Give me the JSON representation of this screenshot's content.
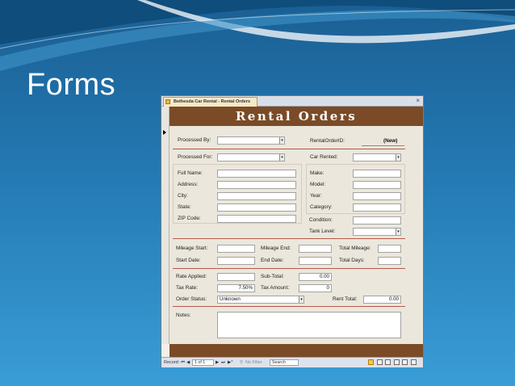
{
  "slide": {
    "title": "Forms"
  },
  "window": {
    "tab_label": "Bethesda Car Rental - Rental Orders",
    "close_glyph": "×",
    "header_title": "Rental Orders"
  },
  "form": {
    "processed_by": {
      "label": "Processed By:",
      "value": ""
    },
    "rental_order_id": {
      "label": "RentalOrderID:",
      "value": "(New)"
    },
    "processed_for": {
      "label": "Processed For:",
      "value": ""
    },
    "car_rented": {
      "label": "Car Rented:",
      "value": ""
    },
    "full_name": {
      "label": "Full Name:",
      "value": ""
    },
    "address": {
      "label": "Address:",
      "value": ""
    },
    "city": {
      "label": "City:",
      "value": ""
    },
    "state": {
      "label": "State:",
      "value": ""
    },
    "zip": {
      "label": "ZIP Code:",
      "value": ""
    },
    "make": {
      "label": "Make:",
      "value": ""
    },
    "model": {
      "label": "Model:",
      "value": ""
    },
    "year": {
      "label": "Year:",
      "value": ""
    },
    "category": {
      "label": "Category:",
      "value": ""
    },
    "condition": {
      "label": "Condition:",
      "value": ""
    },
    "tank_level": {
      "label": "Tank Level:",
      "value": ""
    },
    "mileage_start": {
      "label": "Mileage Start:",
      "value": ""
    },
    "mileage_end": {
      "label": "Mileage End:",
      "value": ""
    },
    "total_mileage": {
      "label": "Total Mileage:",
      "value": ""
    },
    "start_date": {
      "label": "Start Date:",
      "value": ""
    },
    "end_date": {
      "label": "End Date:",
      "value": ""
    },
    "total_days": {
      "label": "Total Days:",
      "value": ""
    },
    "rate_applied": {
      "label": "Rate Applied:",
      "value": ""
    },
    "sub_total": {
      "label": "Sub-Total:",
      "value": "0.00"
    },
    "tax_rate": {
      "label": "Tax Rate:",
      "value": "7.50%"
    },
    "tax_amount": {
      "label": "Tax Amount:",
      "value": "0"
    },
    "order_status": {
      "label": "Order Status:",
      "value": "Unknown"
    },
    "rent_total": {
      "label": "Rent Total:",
      "value": "0.00"
    },
    "notes": {
      "label": "Notes:",
      "value": ""
    }
  },
  "navbar": {
    "record_label": "Record:",
    "first": "⏮",
    "prev": "◀",
    "position": "1 of 1",
    "next": "▶",
    "last": "⏭",
    "new": "▶*",
    "filter": "No Filter",
    "search": "Search"
  },
  "colors": {
    "header_brown": "#7a4b26",
    "divider_red": "#b45a4a",
    "slide_blue": "#2479b3"
  }
}
